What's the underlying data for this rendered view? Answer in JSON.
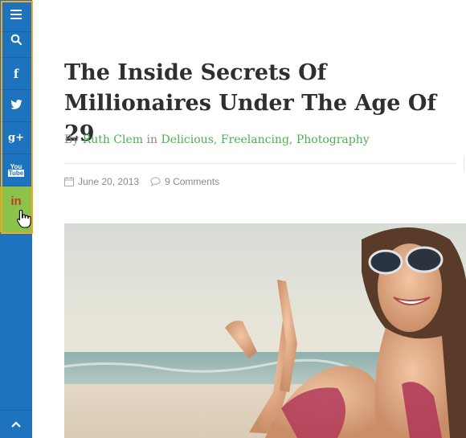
{
  "sidebar": {
    "items": [
      {
        "name": "menu",
        "icon": "menu-icon"
      },
      {
        "name": "search",
        "icon": "search-icon"
      },
      {
        "name": "facebook",
        "icon": "facebook-icon",
        "label": "f"
      },
      {
        "name": "twitter",
        "icon": "twitter-icon"
      },
      {
        "name": "google-plus",
        "icon": "google-plus-icon",
        "label": "g+"
      },
      {
        "name": "youtube",
        "icon": "youtube-icon",
        "label_top": "You",
        "label_bottom": "Tube"
      },
      {
        "name": "linkedin",
        "icon": "linkedin-icon",
        "label": "in",
        "active": true
      }
    ],
    "back_to_top_icon": "chevron-up-icon",
    "colors": {
      "background": "#1e73be",
      "active": "#8bc34a",
      "highlight": "#f5a623"
    }
  },
  "post": {
    "title": "The Inside Secrets Of Millionaires Under The Age Of 29",
    "by_label": "By",
    "author": "Ruth Clem",
    "in_label": "in",
    "categories": [
      "Delicious",
      "Freelancing",
      "Photography"
    ],
    "separator": ", ",
    "date": "June 20, 2013",
    "comments": "9 Comments",
    "link_color": "#4caf50"
  }
}
